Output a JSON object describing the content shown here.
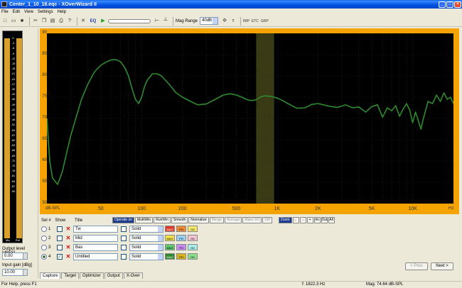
{
  "window": {
    "title": "Center_1_10_18.eqc - XOverWizard II"
  },
  "menu": [
    "File",
    "Edit",
    "View",
    "Settings",
    "Help"
  ],
  "toolbar": {
    "eq_label": "EQ",
    "mag_range_label": "Mag Range",
    "mag_range_value": "40dB",
    "small_labels": [
      "IMP",
      "ETC",
      "GRP"
    ]
  },
  "left": {
    "meter_scale": [
      "0",
      "-3",
      "-6",
      "-9",
      "-12",
      "-15",
      "-18",
      "-21",
      "-24",
      "-27",
      "-30",
      "-33",
      "-36",
      "-39",
      "-42",
      "-45",
      "-48",
      "-51",
      "-54",
      "-57",
      "-60",
      "-63",
      "-66",
      "-69",
      "-72",
      "-75",
      "-78",
      "-81",
      "-84",
      "-87",
      "-90"
    ],
    "meter_left_label": "Mic",
    "meter_right_label": "Ref",
    "output_level_label": "Output level [dBFS]",
    "output_level_value": "0.00",
    "input_gain_label": "Input gain [dBg]",
    "input_gain_value": "10.00"
  },
  "chart_data": {
    "type": "line",
    "ylabel": "dB-SPL",
    "xunit": "Hz",
    "x_scale": "log",
    "xlim": [
      20,
      20000
    ],
    "ylim": [
      50,
      90
    ],
    "x_ticks": [
      "50",
      "100",
      "200",
      "500",
      "1K",
      "2K",
      "5K",
      "10K"
    ],
    "y_ticks": [
      "90",
      "85",
      "80",
      "75",
      "70",
      "65",
      "60",
      "55",
      "50"
    ],
    "shaded_band": [
      700,
      950
    ],
    "series": [
      {
        "color": "#2e8b2e",
        "x": [
          20,
          21,
          22,
          24,
          26,
          28,
          30,
          33,
          36,
          40,
          45,
          50,
          55,
          60,
          65,
          70,
          75,
          80,
          85,
          90,
          95,
          100,
          105,
          110,
          120,
          130,
          140,
          160,
          180,
          200,
          230,
          260,
          300,
          350,
          400,
          450,
          500,
          550,
          600,
          650,
          700,
          750,
          800,
          900,
          1000,
          1100,
          1200,
          1400,
          1600,
          1800,
          2000,
          2200,
          2500,
          2800,
          3200,
          3600,
          4000,
          4500,
          5000,
          5500,
          6000,
          6500,
          7000,
          7500,
          8000,
          8500,
          9000,
          9500,
          10000,
          10500,
          11000,
          11500,
          12000,
          13000,
          14000,
          15000,
          16000,
          17000,
          18000,
          19000,
          20000
        ],
        "values": [
          70,
          60,
          56,
          54.5,
          57.5,
          62,
          66,
          70.5,
          74.5,
          78,
          81,
          82.5,
          83.3,
          83.8,
          83.8,
          83.3,
          82,
          80,
          77,
          74.5,
          73.5,
          75,
          77.5,
          79,
          80.5,
          80.5,
          80,
          78,
          76,
          75,
          74,
          73.2,
          73.4,
          74.5,
          75.5,
          75.8,
          75.5,
          75,
          74.4,
          74.2,
          74.4,
          75,
          75.3,
          75.2,
          74.8,
          74.2,
          73.5,
          72.4,
          72.5,
          73.3,
          73.5,
          73.2,
          72.8,
          72.6,
          73.2,
          72.5,
          72.7,
          71.5,
          72.8,
          73.2,
          70.3,
          72.5,
          71.8,
          73,
          70.5,
          72.2,
          73.5,
          72,
          69,
          71.5,
          69.5,
          67.5,
          70,
          74,
          73.5,
          75.5,
          74,
          76,
          74.5,
          75,
          73.5
        ]
      }
    ]
  },
  "controls": {
    "operate_on_label": "Operate on",
    "buttons": [
      "MultiWin",
      "RunWin",
      "Smooth",
      "Normalize",
      "Merge",
      "Average",
      "Make XO",
      "Diff"
    ],
    "zoom_label": "Zoom",
    "zoom_buttons": [
      "←",
      "→",
      "+",
      "Im",
      "Out",
      "All"
    ]
  },
  "sets": {
    "headers": {
      "set": "Sel #",
      "show": "Show",
      "title": "Title"
    },
    "rows": [
      {
        "num": "1",
        "title": "Tw",
        "style": "Solid",
        "chips": [
          "MAG",
          "PH",
          "GD"
        ],
        "show": false
      },
      {
        "num": "2",
        "title": "Mid",
        "style": "Solid",
        "chips": [
          "MAG",
          "PH",
          "GD"
        ],
        "show": false
      },
      {
        "num": "3",
        "title": "Bas",
        "style": "Solid",
        "chips": [
          "MAG",
          "PH",
          "GD"
        ],
        "show": false
      },
      {
        "num": "4",
        "title": "Untitled",
        "style": "Solid",
        "chips": [
          "MAG",
          "PH",
          "GD"
        ],
        "show": true
      }
    ]
  },
  "nav": {
    "prev": "< Prev",
    "next": "Next >"
  },
  "tabs": [
    "Capture",
    "Target",
    "Optimizer",
    "Output",
    "X-Over"
  ],
  "status": {
    "help": "For Help, press F1",
    "freq": "f: 1822.3 Hz",
    "mag": "Mag: 74.64 dB-SPL"
  }
}
